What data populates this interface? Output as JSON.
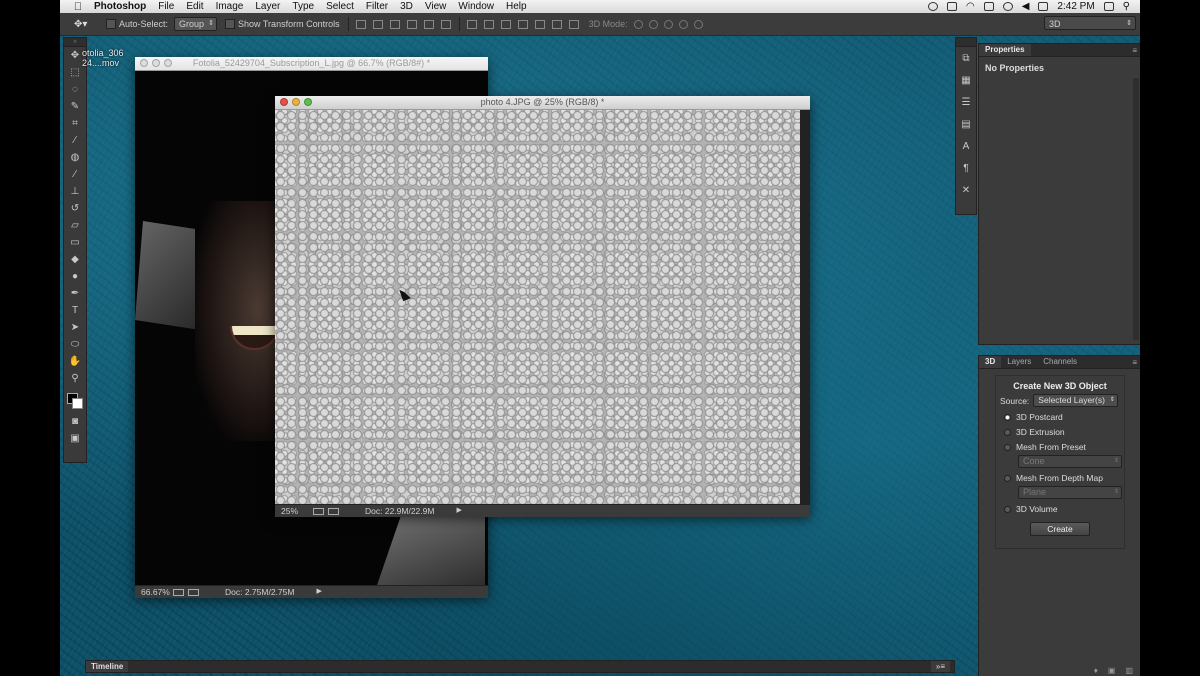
{
  "menubar": {
    "app": "Photoshop",
    "items": [
      "File",
      "Edit",
      "Image",
      "Layer",
      "Type",
      "Select",
      "Filter",
      "3D",
      "View",
      "Window",
      "Help"
    ],
    "clock": "2:42 PM"
  },
  "options_bar": {
    "auto_select_label": "Auto-Select:",
    "auto_select_value": "Group",
    "show_transform_label": "Show Transform Controls",
    "mode_label": "3D Mode:",
    "workspace": "3D"
  },
  "ghost_label": {
    "line1": "otolia_306",
    "line2": "24....mov"
  },
  "doc_back": {
    "title": "Fotolia_52429704_Subscription_L.jpg @ 66.7% (RGB/8#) *",
    "zoom": "66.67%",
    "doc_size": "Doc: 2.75M/2.75M"
  },
  "doc_front": {
    "title": "photo 4.JPG @ 25% (RGB/8) *",
    "zoom": "25%",
    "doc_size": "Doc: 22.9M/22.9M"
  },
  "properties_panel": {
    "tab": "Properties",
    "content": "No Properties"
  },
  "panel_3d": {
    "tabs": [
      "3D",
      "Layers",
      "Channels"
    ],
    "heading": "Create New 3D Object",
    "source_label": "Source:",
    "source_value": "Selected Layer(s)",
    "options": [
      "3D Postcard",
      "3D Extrusion",
      "Mesh From Preset",
      "Mesh From Depth Map",
      "3D Volume"
    ],
    "selected_option": "3D Postcard",
    "preset_value": "Cone",
    "depth_map_value": "Plane",
    "create_button": "Create"
  },
  "timeline": {
    "label": "Timeline"
  },
  "colors": {
    "background_teal": "#0d5068",
    "panel_gray": "#3b3b3b",
    "close_red": "#e5504a",
    "minimize_yellow": "#e9b43a",
    "zoom_green": "#5fbe4b"
  },
  "icons": [
    "apple-icon",
    "move-tool-icon",
    "marquee-tool-icon",
    "lasso-tool-icon",
    "quick-select-icon",
    "crop-tool-icon",
    "eyedropper-icon",
    "healing-brush-icon",
    "brush-tool-icon",
    "clone-stamp-icon",
    "history-brush-icon",
    "eraser-icon",
    "gradient-icon",
    "blur-tool-icon",
    "dodge-tool-icon",
    "pen-tool-icon",
    "type-tool-icon",
    "path-select-icon",
    "shape-tool-icon",
    "hand-tool-icon",
    "zoom-tool-icon"
  ]
}
